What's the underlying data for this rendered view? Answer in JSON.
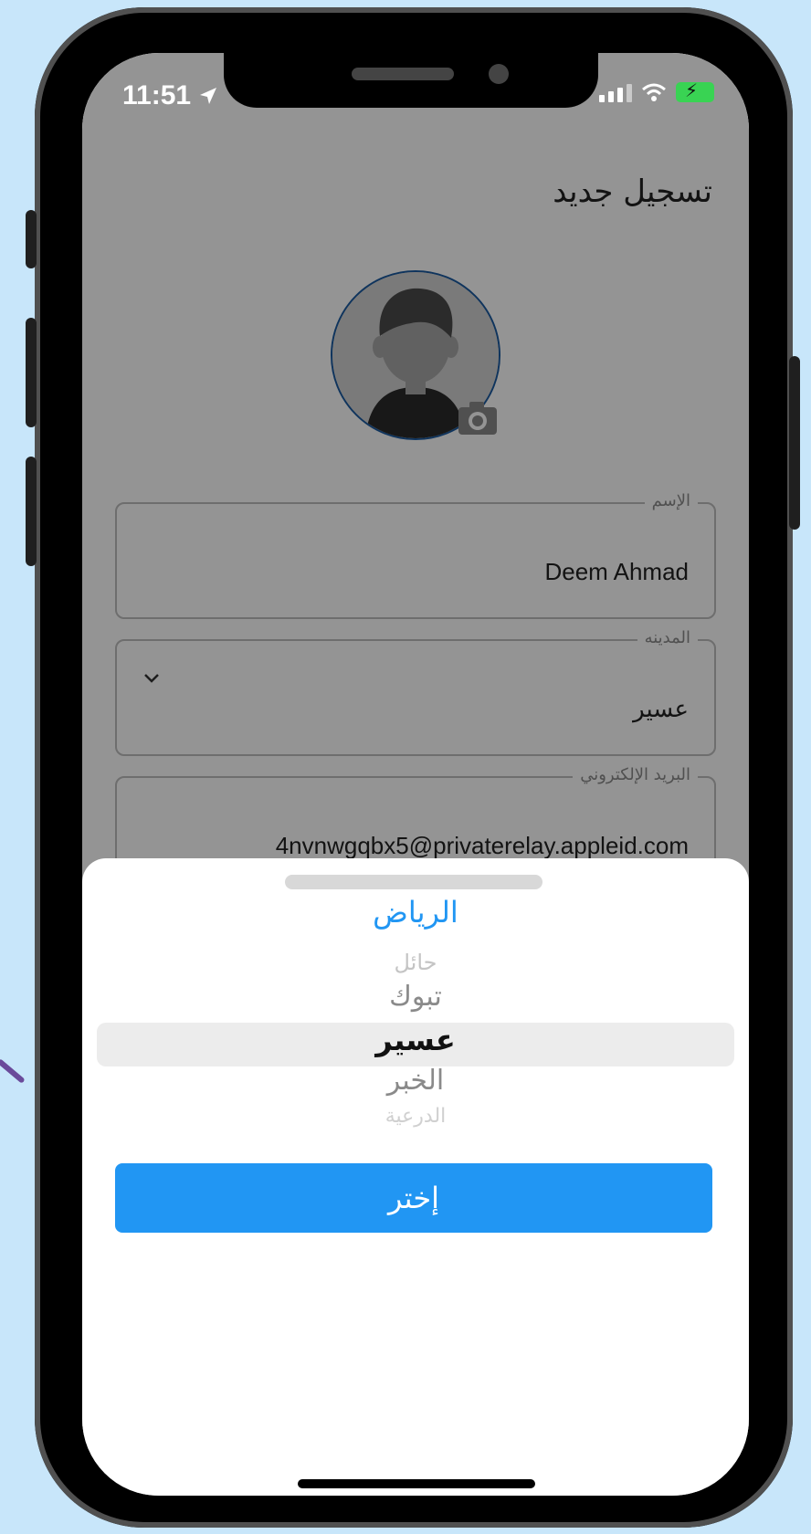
{
  "status_bar": {
    "time": "11:51"
  },
  "page": {
    "title": "تسجيل جديد"
  },
  "form": {
    "name": {
      "label": "الإسم",
      "value": "Deem Ahmad"
    },
    "city": {
      "label": "المدينه",
      "value": "عسير"
    },
    "email": {
      "label": "البريد الإلكتروني",
      "value": "4nvnwgqbx5@privaterelay.appleid.com"
    }
  },
  "picker_sheet": {
    "header": "الرياض",
    "options": [
      "حائل",
      "تبوك",
      "عسير",
      "الخبر",
      "الدرعية"
    ],
    "selected": "عسير",
    "select_label": "إختر"
  },
  "colors": {
    "accent": "#2196f3",
    "background": "#c8e6fa",
    "avatar_ring": "#1a5aa0"
  },
  "icons": {
    "location_arrow": "location-arrow-icon",
    "wifi": "wifi-icon",
    "battery": "battery-charging-icon",
    "chevron": "chevron-down-icon",
    "camera": "camera-icon"
  }
}
